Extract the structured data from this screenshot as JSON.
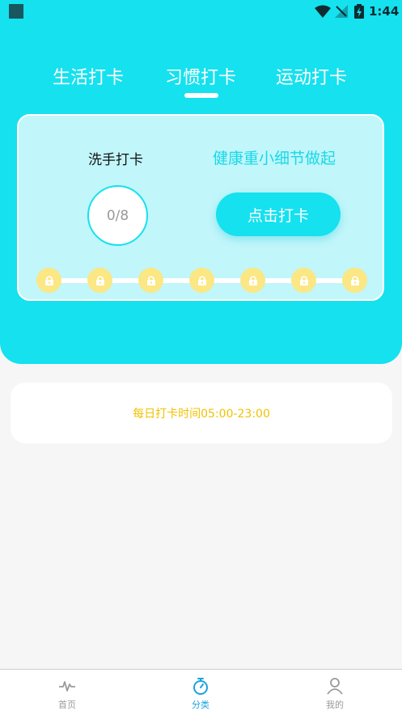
{
  "status_bar": {
    "time": "1:44"
  },
  "tabs": [
    {
      "label": "生活打卡"
    },
    {
      "label": "习惯打卡"
    },
    {
      "label": "运动打卡"
    }
  ],
  "card": {
    "title": "洗手打卡",
    "slogan": "健康重小细节做起",
    "progress": "0/8",
    "button_label": "点击打卡"
  },
  "info": {
    "text": "每日打卡时间05:00-23:00"
  },
  "nav": [
    {
      "label": "首页"
    },
    {
      "label": "分类"
    },
    {
      "label": "我的"
    }
  ],
  "colors": {
    "primary": "#15e1ef",
    "card_bg": "#c1f6fa",
    "lock": "#fbe783",
    "accent_text": "#f2c200",
    "nav_active": "#1aa3e0"
  }
}
